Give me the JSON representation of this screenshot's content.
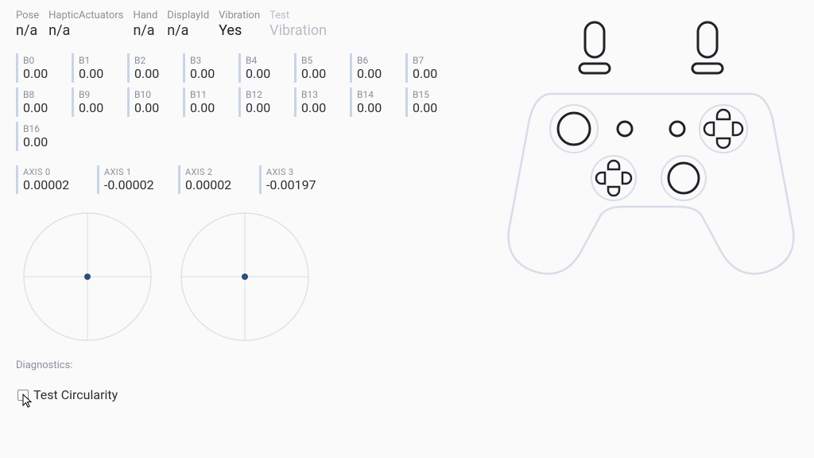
{
  "info": {
    "pose": {
      "label": "Pose",
      "value": "n/a"
    },
    "haptic": {
      "label": "HapticActuators",
      "value": "n/a"
    },
    "hand": {
      "label": "Hand",
      "value": "n/a"
    },
    "display": {
      "label": "DisplayId",
      "value": "n/a"
    },
    "vibration": {
      "label": "Vibration",
      "value": "Yes"
    },
    "test": {
      "label": "Test",
      "value": "Vibration"
    }
  },
  "buttons": [
    {
      "label": "B0",
      "value": "0.00"
    },
    {
      "label": "B1",
      "value": "0.00"
    },
    {
      "label": "B2",
      "value": "0.00"
    },
    {
      "label": "B3",
      "value": "0.00"
    },
    {
      "label": "B4",
      "value": "0.00"
    },
    {
      "label": "B5",
      "value": "0.00"
    },
    {
      "label": "B6",
      "value": "0.00"
    },
    {
      "label": "B7",
      "value": "0.00"
    },
    {
      "label": "B8",
      "value": "0.00"
    },
    {
      "label": "B9",
      "value": "0.00"
    },
    {
      "label": "B10",
      "value": "0.00"
    },
    {
      "label": "B11",
      "value": "0.00"
    },
    {
      "label": "B12",
      "value": "0.00"
    },
    {
      "label": "B13",
      "value": "0.00"
    },
    {
      "label": "B14",
      "value": "0.00"
    },
    {
      "label": "B15",
      "value": "0.00"
    },
    {
      "label": "B16",
      "value": "0.00"
    }
  ],
  "axes": [
    {
      "label": "AXIS 0",
      "value": "0.00002"
    },
    {
      "label": "AXIS 1",
      "value": "-0.00002"
    },
    {
      "label": "AXIS 2",
      "value": "0.00002"
    },
    {
      "label": "AXIS 3",
      "value": "-0.00197"
    }
  ],
  "diagnostics_label": "Diagnostics:",
  "test_circularity_label": "Test Circularity",
  "colors": {
    "accent_line": "#c9d4e6",
    "outline": "#d7dde8",
    "dark": "#1f2227",
    "dot": "#2d4f7a"
  }
}
